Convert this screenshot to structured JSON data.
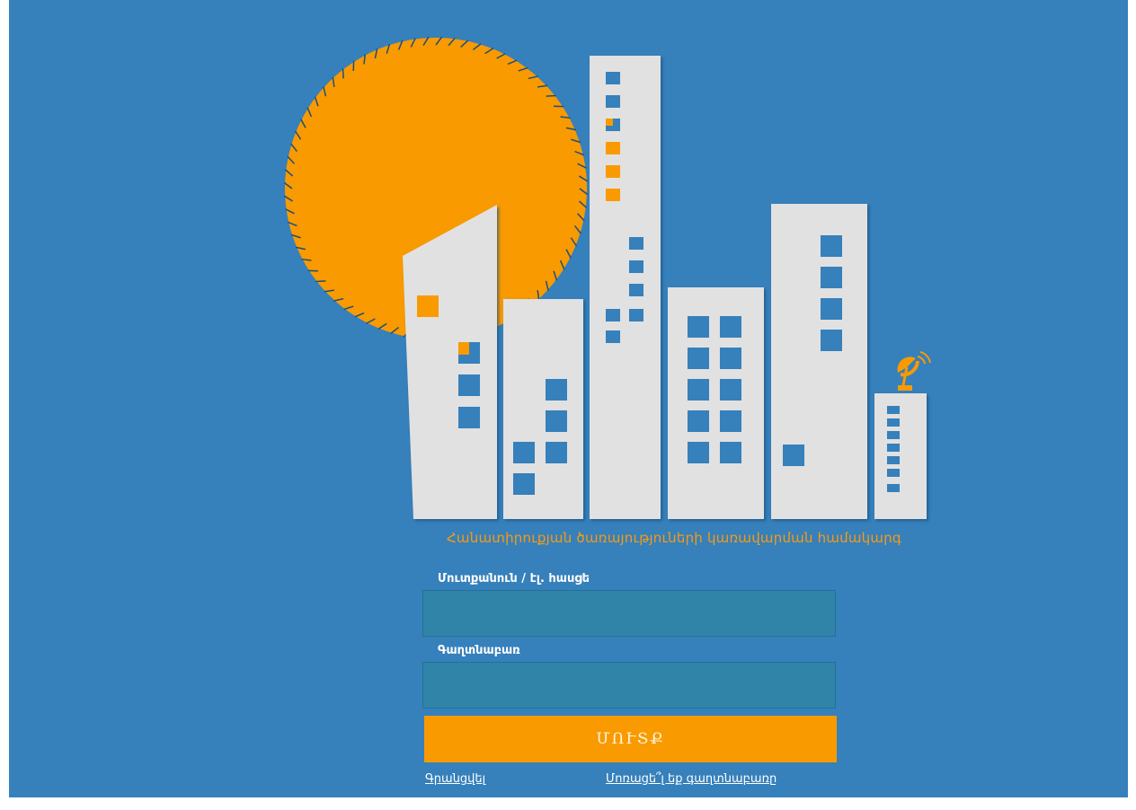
{
  "tagline": "Հանատիրուքյան ծառայություների կառավարման համակարգ",
  "login_form": {
    "username_label": "Մուտքանուն / էլ. հասցե",
    "username_value": "",
    "password_label": "Գաղտնաբառ",
    "password_value": "",
    "submit_label": "ՄՈՒՏՔ"
  },
  "links": {
    "register": "Գրանցվել",
    "forgot_password": "Մոռացե՞լ եք գաղտնաբառը"
  },
  "colors": {
    "background": "#3680bb",
    "accent": "#f99a00",
    "building": "#e1e1e1",
    "input_bg": "#2f84a8"
  },
  "icons": [
    "sun-icon",
    "satellite-dish-icon"
  ]
}
